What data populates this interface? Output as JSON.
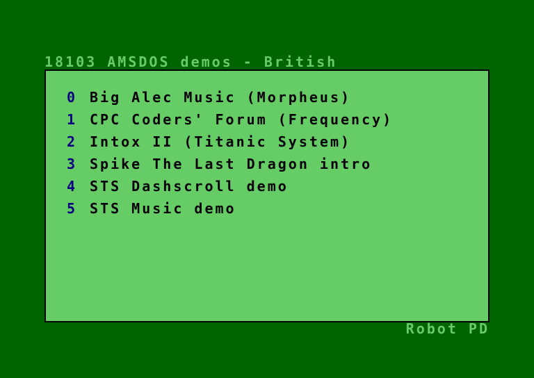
{
  "header": {
    "title": "18103 AMSDOS demos - British"
  },
  "menu": {
    "items": [
      {
        "key": "0",
        "label": "Big Alec Music (Morpheus)"
      },
      {
        "key": "1",
        "label": "CPC Coders' Forum (Frequency)"
      },
      {
        "key": "2",
        "label": "Intox II (Titanic System)"
      },
      {
        "key": "3",
        "label": "Spike The Last Dragon intro"
      },
      {
        "key": "4",
        "label": "STS Dashscroll demo"
      },
      {
        "key": "5",
        "label": "STS Music demo"
      }
    ]
  },
  "footer": {
    "credit": "Robot PD"
  },
  "colors": {
    "background": "#006400",
    "panel": "#66CC66",
    "key_text": "#000080",
    "label_text": "#000000",
    "outer_text": "#66CC66"
  }
}
